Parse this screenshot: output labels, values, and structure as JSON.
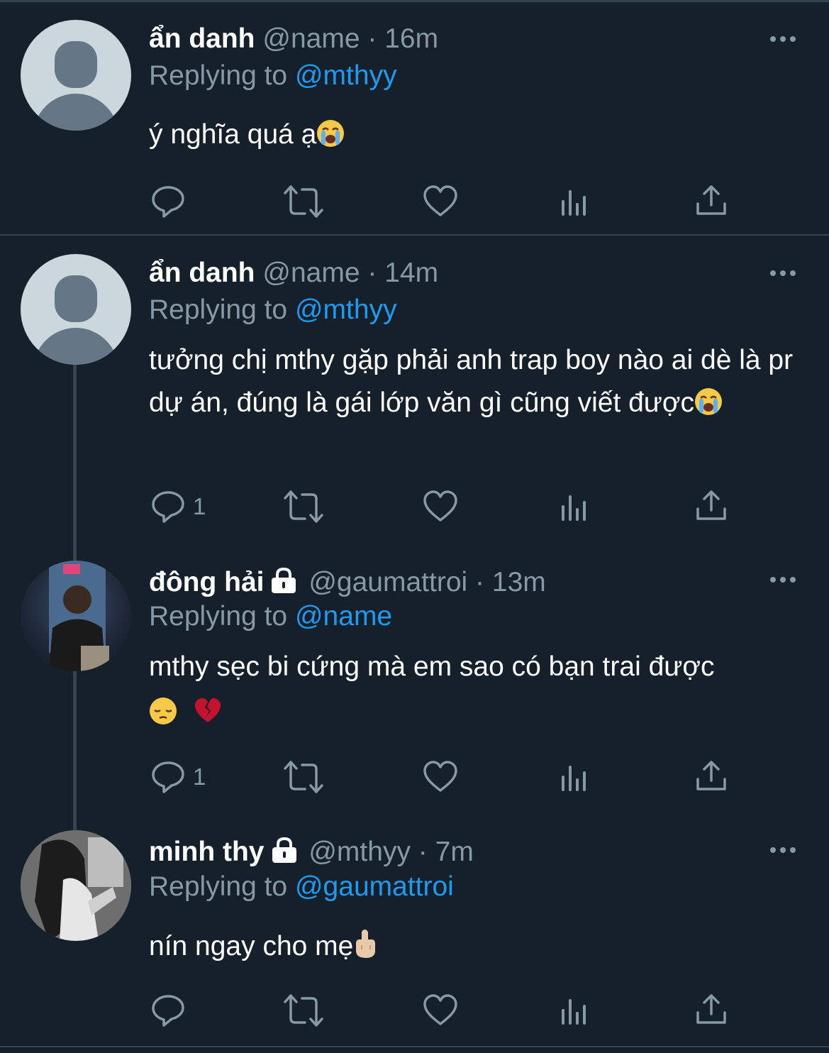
{
  "tweets": [
    {
      "name": "ẩn danh",
      "handle": "@name",
      "dot": "·",
      "time": "16m",
      "reply_prefix": "Replying to",
      "reply_target": "@mthyy",
      "text": "ý nghĩa quá ạ",
      "emoji": "loudly-crying-face",
      "reply_count": "",
      "avatar": "default-avatar"
    },
    {
      "name": "ẩn danh",
      "handle": "@name",
      "dot": "·",
      "time": "14m",
      "reply_prefix": "Replying to",
      "reply_target": "@mthyy",
      "text": "tưởng chị mthy gặp phải anh trap boy nào ai dè là pr dự án, đúng là gái lớp văn gì cũng viết được",
      "emoji": "loudly-crying-face",
      "reply_count": "1",
      "avatar": "default-avatar"
    },
    {
      "name": "đông hải",
      "handle": "@gaumattroi",
      "dot": "·",
      "time": "13m",
      "reply_prefix": "Replying to",
      "reply_target": "@name",
      "text": "mthy sẹc bi cứng mà em sao có bạn trai được",
      "emoji": "pensive-face broken-heart",
      "reply_count": "1",
      "avatar": "photo-avatar",
      "protected": true
    },
    {
      "name": "minh thy",
      "handle": "@mthyy",
      "dot": "·",
      "time": "7m",
      "reply_prefix": "Replying to",
      "reply_target": "@gaumattroi",
      "text": "nín ngay cho mẹ",
      "emoji": "middle-finger",
      "reply_count": "",
      "avatar": "photo-avatar",
      "protected": true
    }
  ],
  "colors": {
    "background": "#15202b",
    "secondary_text": "#8899a6",
    "link": "#1d9bf0",
    "divider": "#38444d"
  }
}
